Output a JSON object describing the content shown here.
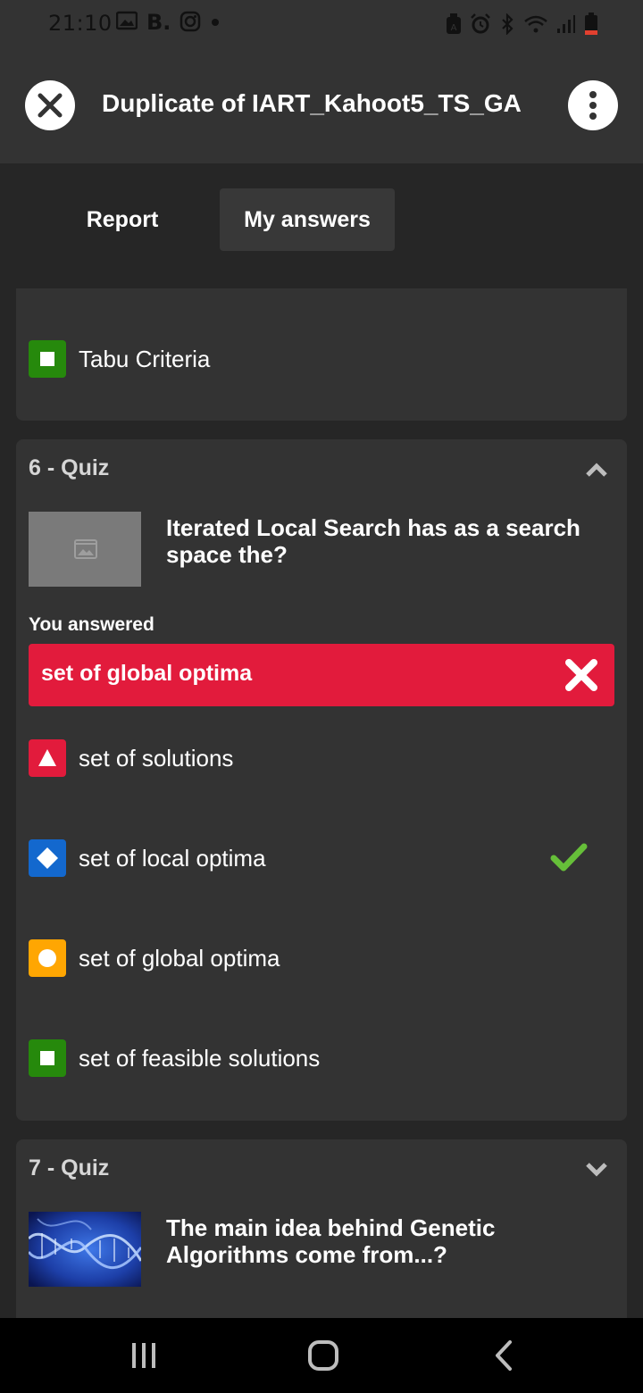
{
  "status_bar": {
    "time": "21:10",
    "left_icons": [
      "gallery-icon",
      "b-icon",
      "instagram-icon",
      "dot-icon"
    ],
    "right_icons": [
      "nfc-icon",
      "alarm-icon",
      "bluetooth-icon",
      "wifi-icon",
      "signal-icon",
      "battery-low-icon"
    ],
    "b_letter": "B."
  },
  "header": {
    "title": "Duplicate of IART_Kahoot5_TS_GA"
  },
  "tabs": [
    {
      "label": "Report",
      "active": false
    },
    {
      "label": "My answers",
      "active": true
    }
  ],
  "previous_card": {
    "option": {
      "shape": "square",
      "color": "#26890c",
      "text": "Tabu Criteria"
    }
  },
  "quiz6": {
    "label": "6 - Quiz",
    "question": "Iterated Local Search has as a search space the?",
    "you_answered_label": "You answered",
    "answer": {
      "text": "set of global optima",
      "correct": false,
      "color": "#e21b3c"
    },
    "options": [
      {
        "shape": "triangle",
        "color": "#e21b3c",
        "text": "set of solutions",
        "correct": false
      },
      {
        "shape": "diamond",
        "color": "#1368ce",
        "text": "set of local optima",
        "correct": true
      },
      {
        "shape": "circle",
        "color": "#ffa602",
        "text": "set of global optima",
        "correct": false
      },
      {
        "shape": "square",
        "color": "#26890c",
        "text": "set of feasible solutions",
        "correct": false
      }
    ],
    "expanded": true
  },
  "quiz7": {
    "label": "7 - Quiz",
    "question": "The main idea behind Genetic Algorithms come from...?",
    "expanded": false
  },
  "colors": {
    "background": "#262626",
    "card": "#333333",
    "wrong": "#e21b3c",
    "correct_check": "#66bf39"
  }
}
